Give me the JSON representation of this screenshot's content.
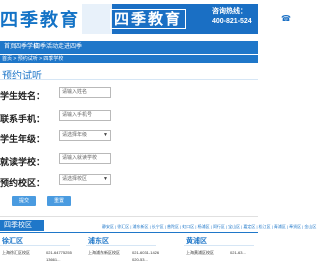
{
  "header": {
    "logo_text": "四季教育",
    "banner_title": "四季教育",
    "hotline_label": "咨询热线：",
    "hotline_number": "400-821-524"
  },
  "nav": {
    "items": [
      "首页",
      "四季学校",
      "四季活动",
      "走进四季"
    ]
  },
  "breadcrumb": "首页 > 预约试听 > 四季学校",
  "section_title": "预约试听",
  "form": {
    "fields": [
      {
        "label": "学生姓名：",
        "placeholder": "请输入姓名",
        "type": "input"
      },
      {
        "label": "联系手机：",
        "placeholder": "请输入手机号",
        "type": "input"
      },
      {
        "label": "学生年级：",
        "placeholder": "请选择年级",
        "type": "select"
      },
      {
        "label": "就读学校：",
        "placeholder": "请输入就读学校",
        "type": "input"
      },
      {
        "label": "预约校区：",
        "placeholder": "请选择校区",
        "type": "select"
      }
    ],
    "submit_label": "提交",
    "reset_label": "重置"
  },
  "footer": {
    "tab_label": "四季校区",
    "district_links": "静安区 | 徐汇区 | 浦东新区 | 长宁区 | 普陀区 | 虹口区 | 杨浦区 | 闵行区 | 宝山区 | 嘉定区 | 松江区 | 青浦区 | 奉贤区 | 金山区",
    "columns": [
      {
        "title": "徐汇区",
        "entries": [
          {
            "name": "上海徐汇区校区",
            "phone": "021-64775255"
          },
          {
            "name": "",
            "phone": "13661..."
          }
        ]
      },
      {
        "title": "浦东区",
        "entries": [
          {
            "name": "上海浦东新区校区",
            "phone": "021-6031-1426"
          },
          {
            "name": "",
            "phone": "020-53..."
          }
        ]
      },
      {
        "title": "黄浦区",
        "entries": [
          {
            "name": "上海黄浦区校区",
            "phone": "021-63..."
          }
        ]
      }
    ]
  }
}
